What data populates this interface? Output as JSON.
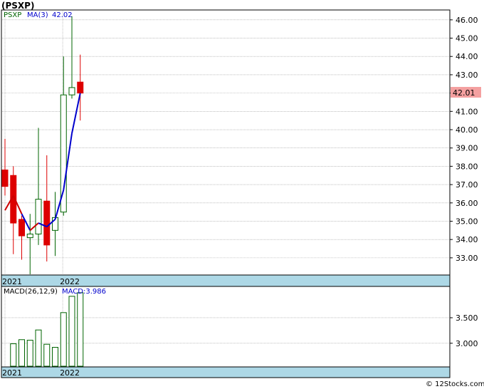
{
  "title": "(PSXP)",
  "watermark": "© 12Stocks.com",
  "colors": {
    "up": "#006400",
    "down": "#dd0000",
    "ma_line": "#0000cc",
    "ma_line_down": "#cc0000",
    "axis_band": "#add8e6",
    "price_label_bg": "#f4a0a0",
    "grid": "#999999"
  },
  "chart_data": [
    {
      "type": "candlestick",
      "legend": {
        "symbol": "PSXP",
        "ma_label": "MA(3)",
        "ma_value": "42.02"
      },
      "last_price_label": "42.01",
      "y_tick_labels": [
        "33.00",
        "34.00",
        "35.00",
        "36.00",
        "37.00",
        "38.00",
        "39.00",
        "40.00",
        "41.00",
        "42.00",
        "43.00",
        "44.00",
        "45.00",
        "46.00"
      ],
      "ylim": [
        32.1,
        46.5
      ],
      "year_labels": [
        {
          "label": "2021",
          "index": 0
        },
        {
          "label": "2022",
          "index": 6.9
        }
      ],
      "candles": [
        {
          "open": 37.8,
          "high": 39.5,
          "low": 36.4,
          "close": 36.9
        },
        {
          "open": 37.5,
          "high": 38.0,
          "low": 33.2,
          "close": 34.9
        },
        {
          "open": 35.1,
          "high": 35.3,
          "low": 32.9,
          "close": 34.2
        },
        {
          "open": 34.1,
          "high": 35.4,
          "low": 32.1,
          "close": 34.3
        },
        {
          "open": 34.3,
          "high": 40.1,
          "low": 33.7,
          "close": 36.2
        },
        {
          "open": 36.1,
          "high": 38.6,
          "low": 32.8,
          "close": 33.7
        },
        {
          "open": 34.5,
          "high": 36.6,
          "low": 33.1,
          "close": 35.2
        },
        {
          "open": 35.5,
          "high": 44.0,
          "low": 35.3,
          "close": 41.9
        },
        {
          "open": 41.9,
          "high": 46.2,
          "low": 41.7,
          "close": 42.3
        },
        {
          "open": 42.6,
          "high": 44.1,
          "low": 40.5,
          "close": 42.0
        }
      ],
      "ma": [
        {
          "value": 35.6,
          "dir": "up"
        },
        {
          "value": 36.4,
          "dir": "down"
        },
        {
          "value": 35.4,
          "dir": "down"
        },
        {
          "value": 34.5,
          "dir": "up"
        },
        {
          "value": 34.9,
          "dir": "down"
        },
        {
          "value": 34.7,
          "dir": "up"
        },
        {
          "value": 35.1,
          "dir": "up"
        },
        {
          "value": 36.7,
          "dir": "up"
        },
        {
          "value": 39.8,
          "dir": "up"
        },
        {
          "value": 42.0,
          "dir": "up"
        }
      ]
    },
    {
      "type": "bar",
      "legend": {
        "label": "MACD(26,12,9)",
        "value_label": "MACD:3.986"
      },
      "y_tick_labels": [
        "3.000",
        "3.500"
      ],
      "ylim": [
        2.55,
        4.1
      ],
      "values": [
        2.99,
        3.07,
        3.06,
        3.26,
        2.98,
        2.92,
        3.6,
        3.92,
        3.99
      ],
      "year_labels": [
        {
          "label": "2021",
          "index": 0
        },
        {
          "label": "2022",
          "index": 6.9
        }
      ]
    }
  ]
}
